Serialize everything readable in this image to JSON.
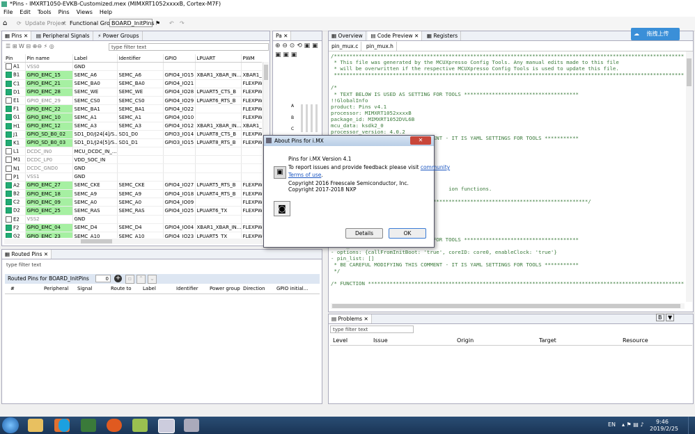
{
  "window": {
    "title": "*Pins - IMXRT1050-EVKB-Customized.mex (MIMXRT1052xxxxB, Cortex-M7F)"
  },
  "menu": [
    "File",
    "Edit",
    "Tools",
    "Pins",
    "Views",
    "Help"
  ],
  "toolbar": {
    "update_project": "Update Project",
    "functional_group_label": "Functional Group",
    "functional_group_value": "BOARD_InitPins"
  },
  "pins_panel": {
    "tabs": [
      "Pins",
      "Peripheral Signals",
      "Power Groups"
    ],
    "filter_placeholder": "type filter text",
    "columns": [
      "Pin",
      "Pin name",
      "Label",
      "Identifier",
      "GPIO",
      "LPUART",
      "PWM"
    ],
    "rows": [
      {
        "pin": "A1",
        "name": "VSS0",
        "label": "GND",
        "id": "",
        "gpio": "",
        "lpuart": "",
        "pwm": "",
        "routed": false
      },
      {
        "pin": "B1",
        "name": "GPIO_EMC_15",
        "label": "SEMC_A6",
        "id": "SEMC_A6",
        "gpio": "GPIO4_IO15",
        "lpuart": "XBAR1_XBAR_IN...",
        "pwm": "XBAR1_X",
        "routed": true
      },
      {
        "pin": "C1",
        "name": "GPIO_EMC_21",
        "label": "SEMC_BA0",
        "id": "SEMC_BA0",
        "gpio": "GPIO4_IO21",
        "lpuart": "",
        "pwm": "FLEXPWI",
        "routed": true
      },
      {
        "pin": "D1",
        "name": "GPIO_EMC_28",
        "label": "SEMC_WE",
        "id": "SEMC_WE",
        "gpio": "GPIO4_IO28",
        "lpuart": "LPUART5_CTS_B",
        "pwm": "FLEXPWI",
        "routed": true
      },
      {
        "pin": "E1",
        "name": "GPIO_EMC_29",
        "label": "SEMC_CS0",
        "id": "SEMC_CS0",
        "gpio": "GPIO4_IO29",
        "lpuart": "LPUART6_RTS_B",
        "pwm": "FLEXPWI",
        "routed": false
      },
      {
        "pin": "F1",
        "name": "GPIO_EMC_22",
        "label": "SEMC_BA1",
        "id": "SEMC_BA1",
        "gpio": "GPIO4_IO22",
        "lpuart": "",
        "pwm": "FLEXPWI",
        "routed": true
      },
      {
        "pin": "G1",
        "name": "GPIO_EMC_10",
        "label": "SEMC_A1",
        "id": "SEMC_A1",
        "gpio": "GPIO4_IO10",
        "lpuart": "",
        "pwm": "FLEXPWI",
        "routed": true
      },
      {
        "pin": "H1",
        "name": "GPIO_EMC_12",
        "label": "SEMC_A3",
        "id": "SEMC_A3",
        "gpio": "GPIO4_IO12",
        "lpuart": "XBAR1_XBAR_IN...",
        "pwm": "XBAR1_X",
        "routed": true
      },
      {
        "pin": "J1",
        "name": "GPIO_SD_B0_02",
        "label": "SD1_D0/J24[4]/S...",
        "id": "SD1_D0",
        "gpio": "GPIO3_IO14",
        "lpuart": "LPUART8_CTS_B",
        "pwm": "FLEXPWI",
        "routed": true
      },
      {
        "pin": "K1",
        "name": "GPIO_SD_B0_03",
        "label": "SD1_D1/J24[5]/S...",
        "id": "SD1_D1",
        "gpio": "GPIO3_IO15",
        "lpuart": "LPUART8_RTS_B",
        "pwm": "FLEXPWI",
        "routed": true
      },
      {
        "pin": "L1",
        "name": "DCDC_IN0",
        "label": "MCU_DCDC_IN_...",
        "id": "",
        "gpio": "",
        "lpuart": "",
        "pwm": "",
        "routed": false
      },
      {
        "pin": "M1",
        "name": "DCDC_LP0",
        "label": "VDD_SOC_IN",
        "id": "",
        "gpio": "",
        "lpuart": "",
        "pwm": "",
        "routed": false
      },
      {
        "pin": "N1",
        "name": "DCDC_GND0",
        "label": "GND",
        "id": "",
        "gpio": "",
        "lpuart": "",
        "pwm": "",
        "routed": false
      },
      {
        "pin": "P1",
        "name": "VSS1",
        "label": "GND",
        "id": "",
        "gpio": "",
        "lpuart": "",
        "pwm": "",
        "routed": false
      },
      {
        "pin": "A2",
        "name": "GPIO_EMC_27",
        "label": "SEMC_CKE",
        "id": "SEMC_CKE",
        "gpio": "GPIO4_IO27",
        "lpuart": "LPUART5_RTS_B",
        "pwm": "FLEXPWI",
        "routed": true
      },
      {
        "pin": "B2",
        "name": "GPIO_EMC_18",
        "label": "SEMC_A9",
        "id": "SEMC_A9",
        "gpio": "GPIO4_IO18",
        "lpuart": "LPUART4_RTS_B",
        "pwm": "FLEXPWI",
        "routed": true
      },
      {
        "pin": "C2",
        "name": "GPIO_EMC_09",
        "label": "SEMC_A0",
        "id": "SEMC_A0",
        "gpio": "GPIO4_IO09",
        "lpuart": "",
        "pwm": "FLEXPWI",
        "routed": true
      },
      {
        "pin": "D2",
        "name": "GPIO_EMC_25",
        "label": "SEMC_RAS",
        "id": "SEMC_RAS",
        "gpio": "GPIO4_IO25",
        "lpuart": "LPUART6_TX",
        "pwm": "FLEXPWI",
        "routed": true
      },
      {
        "pin": "E2",
        "name": "VSS2",
        "label": "GND",
        "id": "",
        "gpio": "",
        "lpuart": "",
        "pwm": "",
        "routed": false
      },
      {
        "pin": "F2",
        "name": "GPIO_EMC_04",
        "label": "SEMC_D4",
        "id": "SEMC_D4",
        "gpio": "GPIO4_IO04",
        "lpuart": "XBAR1_XBAR_IN...",
        "pwm": "FLEXPWI",
        "routed": true
      },
      {
        "pin": "G2",
        "name": "GPIO_EMC_23",
        "label": "SEMC_A10",
        "id": "SEMC_A10",
        "gpio": "GPIO4_IO23",
        "lpuart": "LPUART5_TX",
        "pwm": "FLEXPWI",
        "routed": true
      },
      {
        "pin": "H2",
        "name": "GPIO_SD_B0_01",
        "label": "SD1_D2",
        "id": "SD1_D2",
        "gpio": "GPIO3_IO16",
        "lpuart": "LPUART8_TX[...]",
        "pwm": "FLEXPWI",
        "routed": true
      }
    ]
  },
  "package_panel": {
    "tab": "Pa",
    "row_labels": [
      "A",
      "B",
      "C"
    ]
  },
  "routed_panel": {
    "tab": "Routed Pins",
    "filter_placeholder": "type filter text",
    "header_label": "Routed Pins for BOARD_InitPins",
    "count": "0",
    "columns": [
      "#",
      "Peripheral",
      "Signal",
      "Route to",
      "Label",
      "Identifier",
      "Power group",
      "Direction",
      "GPIO initial..."
    ]
  },
  "editor": {
    "tabs": [
      "Overview",
      "Code Preview",
      "Registers"
    ],
    "file_tabs": [
      "pin_mux.c",
      "pin_mux.h"
    ],
    "cloud_label": "拖拽上传",
    "lines": [
      "/***********************************************************************************************************************",
      " * This file was generated by the MCUXpresso Config Tools. Any manual edits made to this file",
      " * will be overwritten if the respective MCUXpresso Config Tools is used to update this file.",
      " **********************************************************************************************************************/",
      "",
      "/*",
      " * TEXT BELOW IS USED AS SETTING FOR TOOLS *************************************",
      "!!GlobalInfo",
      "product: Pins v4.1",
      "processor: MIMXRT1052xxxxB",
      "package_id: MIMXRT1052DVL6B",
      "mcu_data: ksdk2_0",
      "processor_version: 4.0.2",
      " * BE CAREFUL MODIFYING THIS COMMENT - IT IS YAML SETTINGS FOR TOOLS ***********",
      "",
      "",
      "",
      "",
      "",
      "",
      "",
      "                                      ion functions.",
      "",
      "***********************************************************************************/",
      "",
      "",
      "",
      "",
      "/*",
      " * TEXT BELOW IS USED AS SETTING FOR TOOLS *************************************",
      "BOARD_InitPins:",
      "- options: {callFromInitBoot: 'true', coreID: core0, enableClock: 'true'}",
      "- pin_list: []",
      " * BE CAREFUL MODIFYING THIS COMMENT - IT IS YAML SETTINGS FOR TOOLS ***********",
      " */",
      "",
      "/* FUNCTION ************************************************************************************************************"
    ]
  },
  "problems": {
    "tab": "Problems",
    "filter_placeholder": "type filter text",
    "columns": [
      "Level",
      "Issue",
      "Origin",
      "Target",
      "Resource"
    ]
  },
  "about": {
    "title": "About Pins for i.MX",
    "version": "Pins for i.MX Version 4.1",
    "feedback": "To report issues and provide feedback please visit",
    "community": "community",
    "terms": "Terms of use",
    "copyright1": "Copyright 2016 Freescale Semiconductor, Inc.",
    "copyright2": "Copyright 2017-2018 NXP",
    "details": "Details",
    "ok": "OK"
  },
  "taskbar": {
    "lang": "EN",
    "time": "9:46",
    "date": "2019/2/25"
  }
}
